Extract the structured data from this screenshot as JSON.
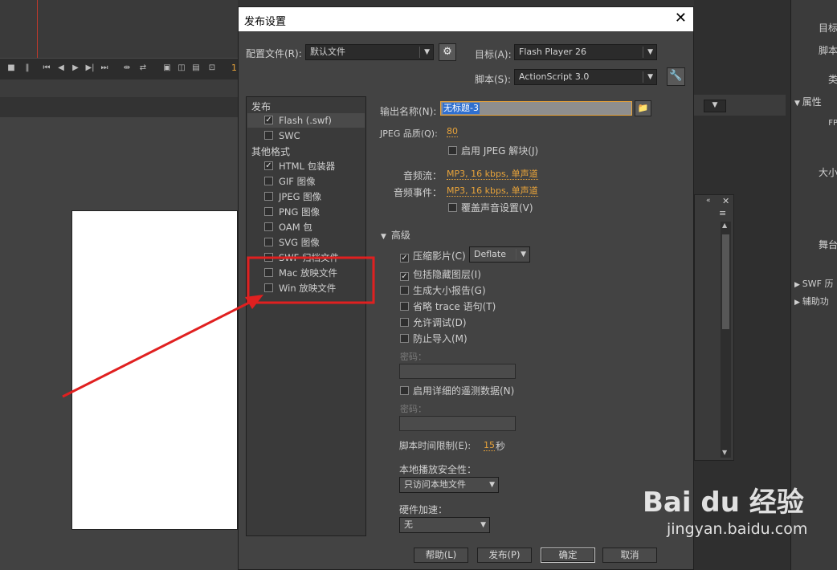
{
  "dialog": {
    "title": "发布设置",
    "profile_label": "配置文件(R):",
    "profile_value": "默认文件",
    "target_label": "目标(A):",
    "target_value": "Flash Player 26",
    "script_label": "脚本(S):",
    "script_value": "ActionScript 3.0"
  },
  "left_list": {
    "publish_header": "发布",
    "other_header": "其他格式",
    "items": [
      {
        "label": "Flash (.swf)",
        "checked": true,
        "selected": true
      },
      {
        "label": "SWC",
        "checked": false
      },
      {
        "label": "HTML 包装器",
        "checked": true
      },
      {
        "label": "GIF 图像",
        "checked": false
      },
      {
        "label": "JPEG 图像",
        "checked": false
      },
      {
        "label": "PNG 图像",
        "checked": false
      },
      {
        "label": "OAM 包",
        "checked": false
      },
      {
        "label": "SVG 图像",
        "checked": false
      },
      {
        "label": "SWF 归档文件",
        "checked": false
      },
      {
        "label": "Mac 放映文件",
        "checked": false
      },
      {
        "label": "Win 放映文件",
        "checked": false
      }
    ]
  },
  "settings": {
    "output_name_label": "输出名称(N):",
    "output_name_value": "无标题-3",
    "jpeg_quality_label": "JPEG 品质(Q):",
    "jpeg_quality_value": "80",
    "enable_jpeg_label": "启用 JPEG 解块(J)",
    "audio_stream_label": "音频流：",
    "audio_stream_value": "MP3, 16 kbps, 单声道",
    "audio_event_label": "音频事件：",
    "audio_event_value": "MP3, 16 kbps, 单声道",
    "override_sound_label": "覆盖声音设置(V)",
    "advanced_label": "高级",
    "compress_label": "压缩影片(C)",
    "compress_value": "Deflate",
    "hidden_layers_label": "包括隐藏图层(I)",
    "size_report_label": "生成大小报告(G)",
    "omit_trace_label": "省略 trace 语句(T)",
    "allow_debug_label": "允许调试(D)",
    "protect_import_label": "防止导入(M)",
    "password_label_1": "密码：",
    "telemetry_label": "启用详细的遥测数据(N)",
    "password_label_2": "密码：",
    "script_time_label": "脚本时间限制(E):",
    "script_time_value": "15",
    "script_time_unit": "秒",
    "local_security_label": "本地播放安全性：",
    "local_security_value": "只访问本地文件",
    "hw_accel_label": "硬件加速：",
    "hw_accel_value": "无"
  },
  "buttons": {
    "help": "帮助(L)",
    "publish": "发布(P)",
    "ok": "确定",
    "cancel": "取消"
  },
  "right_panel": {
    "target_short": "目标",
    "script_short": "脚本",
    "class_short": "类",
    "properties": "属性",
    "fps_short": "FP",
    "size_short": "大小",
    "stage_short": "舞台",
    "swf_history": "SWF 历",
    "accessibility": "辅助功"
  },
  "timeline": {
    "frame_marker": "1"
  },
  "watermark": {
    "logo": "Bai du 经验",
    "url": "jingyan.baidu.com"
  },
  "colors": {
    "link": "#e8a33a",
    "annotation": "#e02020",
    "selection": "#2f6fcf"
  }
}
